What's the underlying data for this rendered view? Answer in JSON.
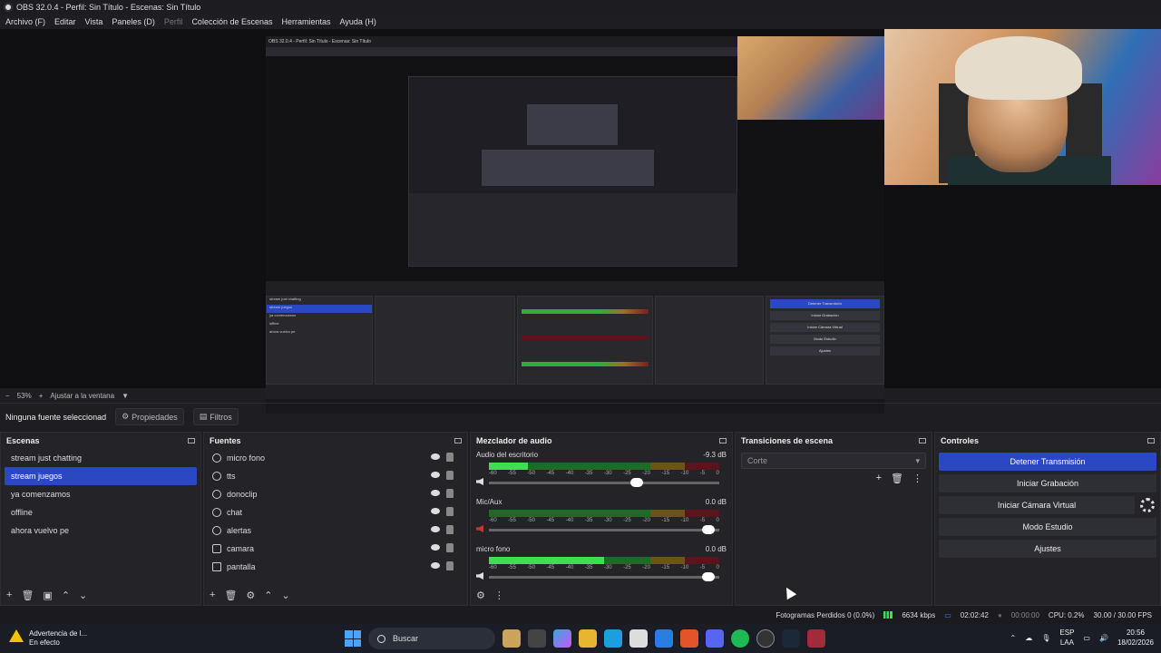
{
  "window": {
    "title": "OBS 32.0.4 - Perfil: Sin Título - Escenas: Sin Título"
  },
  "menu": [
    "Archivo (F)",
    "Editar",
    "Vista",
    "Paneles (D)",
    "Perfil",
    "Colección de Escenas",
    "Herramientas",
    "Ayuda (H)"
  ],
  "nested_preview": {
    "title": "OBS 32.0.4 - Perfil: Sin Título - Escenas: Sin Título",
    "scenes": [
      "stream just chatting",
      "stream juegos",
      "ya comenzamos",
      "offline",
      "ahora vuelvo pe"
    ],
    "controls": [
      "Detener Transmisión",
      "Iniciar Grabación",
      "Iniciar Cámara Virtual",
      "Modo Estudio",
      "Ajustes"
    ]
  },
  "zoom": {
    "level": "53%",
    "fit_label": "Ajustar a la ventana"
  },
  "source_bar": {
    "no_source": "Ninguna fuente seleccionad",
    "properties": "Propiedades",
    "filters": "Filtros"
  },
  "scenes": {
    "title": "Escenas",
    "items": [
      "stream just chatting",
      "stream juegos",
      "ya comenzamos",
      "offline",
      "ahora vuelvo pe"
    ],
    "selected_index": 1
  },
  "sources": {
    "title": "Fuentes",
    "items": [
      "micro fono",
      "tts",
      "donoclip",
      "chat",
      "alertas",
      "camara",
      "pantalla"
    ]
  },
  "mixer": {
    "title": "Mezclador de audio",
    "scale": [
      "-60",
      "-55",
      "-50",
      "-45",
      "-40",
      "-35",
      "-30",
      "-25",
      "-20",
      "-15",
      "-10",
      "-5",
      "0"
    ],
    "channels": [
      {
        "name": "Audio del escritorio",
        "db": "-9.3 dB",
        "level": 0.17,
        "volume": 0.67,
        "muted": false
      },
      {
        "name": "Mic/Aux",
        "db": "0.0 dB",
        "level": 0.0,
        "volume": 0.98,
        "muted": true
      },
      {
        "name": "micro fono",
        "db": "0.0 dB",
        "level": 0.5,
        "volume": 0.98,
        "muted": false
      }
    ]
  },
  "transitions": {
    "title": "Transiciones de escena",
    "selected": "Corte"
  },
  "controls": {
    "title": "Controles",
    "stop_stream": "Detener Transmisión",
    "start_recording": "Iniciar Grabación",
    "start_virtual_cam": "Iniciar Cámara Virtual",
    "studio_mode": "Modo Estudio",
    "settings": "Ajustes"
  },
  "status": {
    "dropped_frames": "Fotogramas Perdidos 0 (0.0%)",
    "bitrate": "6634 kbps",
    "stream_time": "02:02:42",
    "rec_time": "00:00:00",
    "cpu": "CPU: 0.2%",
    "fps": "30.00 / 30.00 FPS"
  },
  "taskbar": {
    "warning_title": "Advertencia de l...",
    "warning_sub": "En efecto",
    "search": "Buscar",
    "lang_top": "ESP",
    "lang_bottom": "LAA",
    "time": "20:56",
    "date": "18/02/2026"
  },
  "colors": {
    "accent": "#2b48c4",
    "panel": "#232328",
    "meter_green": "#3ddf4c"
  }
}
